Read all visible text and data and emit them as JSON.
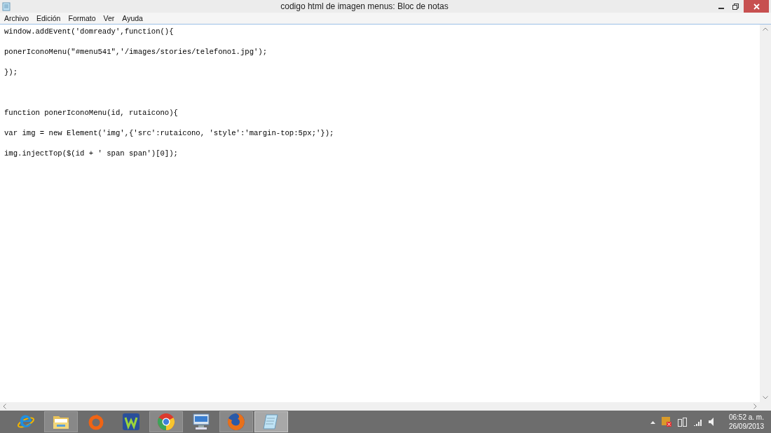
{
  "window": {
    "title": "codigo html de imagen menus: Bloc de notas"
  },
  "menu": [
    "Archivo",
    "Edición",
    "Formato",
    "Ver",
    "Ayuda"
  ],
  "editor": {
    "content": "window.addEvent('domready',function(){\n\nponerIconoMenu(\"#menu541\",'/images/stories/telefono1.jpg');\n\n});\n\n\n\nfunction ponerIconoMenu(id, rutaicono){\n\nvar img = new Element('img',{'src':rutaicono, 'style':'margin-top:5px;'});\n\nimg.injectTop($(id + ' span span')[0]);"
  },
  "taskbar": {
    "apps": [
      {
        "kind": "ie",
        "running": false,
        "selected": false
      },
      {
        "kind": "folder",
        "running": true,
        "selected": false
      },
      {
        "kind": "origin",
        "running": false,
        "selected": false
      },
      {
        "kind": "w",
        "running": false,
        "selected": false
      },
      {
        "kind": "chrome",
        "running": true,
        "selected": false
      },
      {
        "kind": "monitor",
        "running": false,
        "selected": false
      },
      {
        "kind": "firefox",
        "running": true,
        "selected": false
      },
      {
        "kind": "notepad",
        "running": true,
        "selected": true
      }
    ],
    "tray": {
      "time": "06:52 a. m.",
      "date": "26/09/2013"
    }
  }
}
